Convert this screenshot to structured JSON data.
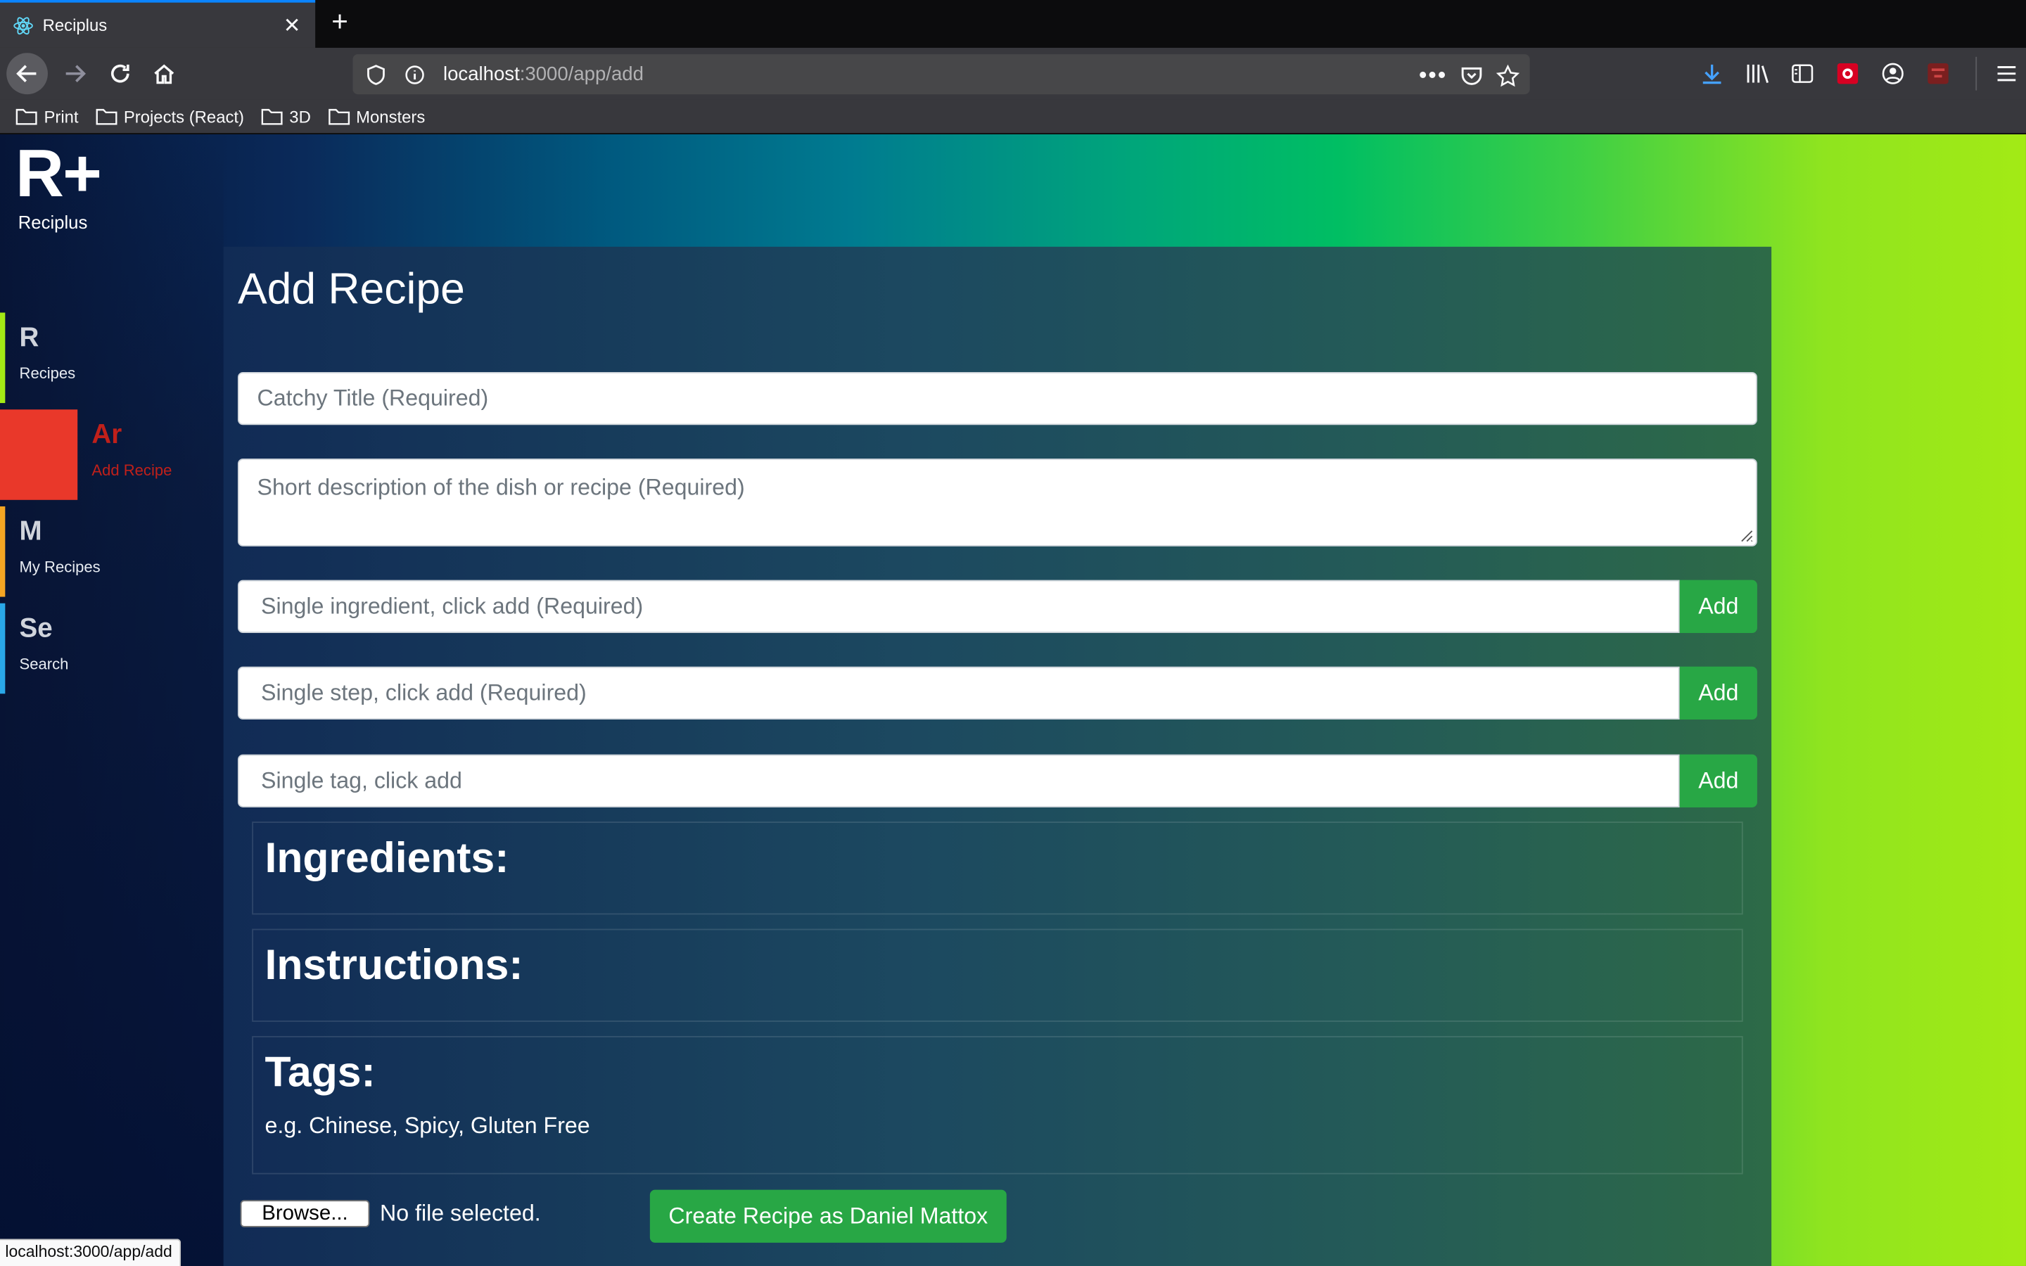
{
  "browser": {
    "tab_title": "Reciplus",
    "url_host": "localhost",
    "url_path": ":3000/app/add",
    "bookmarks": [
      "Print",
      "Projects (React)",
      "3D",
      "Monsters"
    ],
    "status_url": "localhost:3000/app/add",
    "accent": "#0a84ff"
  },
  "app": {
    "logo_mark": "R+",
    "logo_name": "Reciplus"
  },
  "sidebar": {
    "items": [
      {
        "abbr": "R",
        "label": "Recipes",
        "color": "#a3ea15"
      },
      {
        "abbr": "Ar",
        "label": "Add Recipe",
        "color": "#e9382a",
        "active": true
      },
      {
        "abbr": "M",
        "label": "My Recipes",
        "color": "#f5a623"
      },
      {
        "abbr": "Se",
        "label": "Search",
        "color": "#2aa8e8"
      }
    ]
  },
  "form": {
    "title": "Add Recipe",
    "title_placeholder": "Catchy Title (Required)",
    "description_placeholder": "Short description of the dish or recipe (Required)",
    "ingredient_placeholder": "Single ingredient, click add (Required)",
    "step_placeholder": "Single step, click add (Required)",
    "tag_placeholder": "Single tag, click add",
    "add_label": "Add",
    "ingredients_heading": "Ingredients:",
    "instructions_heading": "Instructions:",
    "tags_heading": "Tags:",
    "tags_hint": "e.g. Chinese, Spicy, Gluten Free",
    "browse_label": "Browse...",
    "file_status": "No file selected.",
    "create_label": "Create Recipe as Daniel Mattox",
    "button_color": "#28a745"
  }
}
